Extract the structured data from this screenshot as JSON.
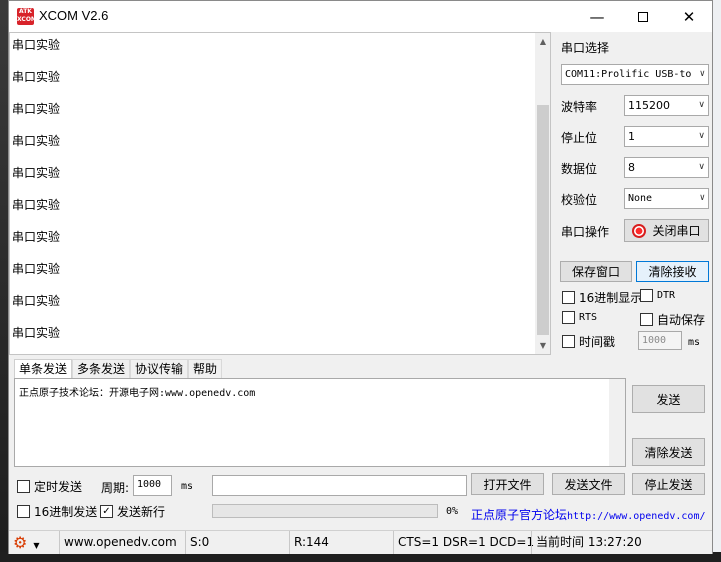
{
  "window": {
    "title": "XCOM V2.6",
    "logo_text": "ATK XCOM"
  },
  "receive": {
    "lines": [
      "串口实验",
      "串口实验",
      "串口实验",
      "串口实验",
      "串口实验",
      "串口实验",
      "串口实验",
      "串口实验",
      "串口实验",
      "串口实验"
    ]
  },
  "panel": {
    "port_select_label": "串口选择",
    "port_value": "COM11:Prolific USB-to",
    "baud_label": "波特率",
    "baud_value": "115200",
    "stopbit_label": "停止位",
    "stopbit_value": "1",
    "databit_label": "数据位",
    "databit_value": "8",
    "parity_label": "校验位",
    "parity_value": "None",
    "op_label": "串口操作",
    "close_port_label": "关闭串口",
    "save_window_label": "保存窗口",
    "clear_receive_label": "清除接收",
    "hex_display_label": "16进制显示",
    "dtr_label": "DTR",
    "rts_label": "RTS",
    "auto_save_label": "自动保存",
    "timestamp_label": "时间戳",
    "timestamp_value": "1000",
    "timestamp_unit": "ms"
  },
  "tabs": [
    "单条发送",
    "多条发送",
    "协议传输",
    "帮助"
  ],
  "send": {
    "text": "正点原子技术论坛：开源电子网:www.openedv.com",
    "send_label": "发送",
    "clear_send_label": "清除发送",
    "timed_send_label": "定时发送",
    "period_label": "周期:",
    "period_value": "1000",
    "period_unit": "ms",
    "open_file_label": "打开文件",
    "send_file_label": "发送文件",
    "stop_send_label": "停止发送",
    "hex_send_label": "16进制发送",
    "newline_label": "发送新行",
    "newline_checked": true,
    "progress_text": "0%",
    "progress": 0,
    "forum_label": "正点原子官方论坛",
    "forum_url": "http://www.openedv.com/"
  },
  "status": {
    "website": "www.openedv.com",
    "sent": "S:0",
    "received": "R:144",
    "signals": "CTS=1 DSR=1 DCD=1",
    "time": "当前时间 13:27:20"
  },
  "colors": {
    "accent": "#0078d7",
    "logo": "#d8232a",
    "settings_icon": "#d83b01"
  }
}
